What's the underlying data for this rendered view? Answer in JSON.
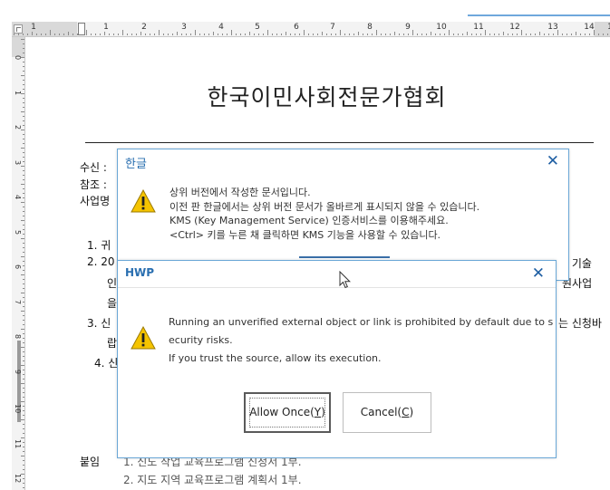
{
  "ruler": {
    "horizontal_numbers": [
      "1",
      "1",
      "2",
      "3",
      "4",
      "5",
      "6",
      "7",
      "8",
      "9",
      "10",
      "11",
      "12",
      "13",
      "14",
      "1"
    ],
    "vertical_numbers": [
      "0",
      "1",
      "2",
      "3",
      "4",
      "5",
      "6",
      "7",
      "8",
      "9",
      "10",
      "11",
      "12"
    ]
  },
  "document": {
    "title": "한국이민사회전문가협회",
    "fragments": {
      "recipient": "수신 :",
      "reference": "참조 :",
      "project": "사업명",
      "item1": "1. 귀",
      "item2": "2. 20",
      "item2_line2": "인",
      "item2_line3": "을",
      "item3": "3. 신",
      "item3_line2": "랍",
      "item4": "4. 신",
      "right_tail1": "는 기술",
      "right_tail2": "원사업",
      "right_tail3": "는 신청바",
      "attachment": "붙임",
      "attach_item1": "1. 신도 작업 교육프로그램 신청서 1부.",
      "attach_item2": "2. 지도 지역 교육프로그램 계획서 1부."
    }
  },
  "dialog_hangul": {
    "title": "한글",
    "close_icon": "close-icon",
    "warning_icon": "warning-icon",
    "message_lines": [
      "상위 버전에서 작성한 문서입니다.",
      "이전 판 한글에서는 상위 버전 문서가 올바르게 표시되지 않을 수 있습니다.",
      "KMS (Key Management Service) 인증서비스를 이용해주세요.",
      "<Ctrl> 키를 누른 채 클릭하면 KMS 기능을 사용할 수 있습니다."
    ]
  },
  "dialog_hwp": {
    "title": "HWP",
    "close_icon": "close-icon",
    "warning_icon": "warning-icon",
    "message_lines": [
      "Running an unverified external object or link is prohibited by default due to s",
      "ecurity risks.",
      "If you trust the source, allow its execution."
    ],
    "allow_button": {
      "label": "Allow Once(",
      "mnemonic": "Y",
      "suffix": ")"
    },
    "cancel_button": {
      "label": "Cancel(",
      "mnemonic": "C",
      "suffix": ")"
    }
  },
  "colors": {
    "dialog_border": "#6aa7d6",
    "dialog_title": "#2a6fb0",
    "close_icon": "#1f5fa3",
    "warning_yellow": "#f5c400"
  }
}
